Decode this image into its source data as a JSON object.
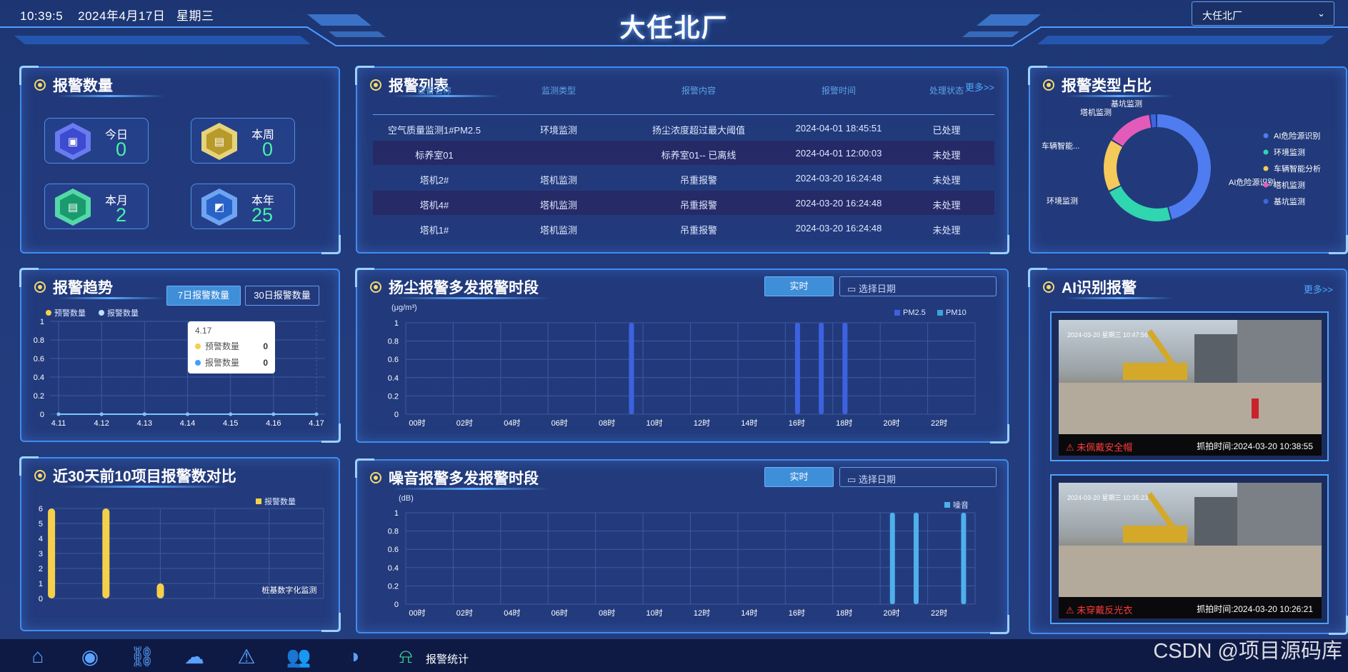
{
  "header": {
    "time": "10:39:5",
    "date": "2024年4月17日",
    "weekday": "星期三",
    "title": "大任北厂",
    "factory_select": "大任北厂"
  },
  "alarm_count": {
    "title": "报警数量",
    "cards": [
      {
        "label": "今日",
        "value": "0",
        "icon": "window-icon",
        "color": "#4d59d8"
      },
      {
        "label": "本周",
        "value": "0",
        "icon": "card-icon",
        "color": "#d4b83e"
      },
      {
        "label": "本月",
        "value": "2",
        "icon": "card-icon",
        "color": "#2bbf8a"
      },
      {
        "label": "本年",
        "value": "25",
        "icon": "chart-icon",
        "color": "#3a7ae0"
      }
    ]
  },
  "alarm_list": {
    "title": "报警列表",
    "more": "更多>>",
    "columns": [
      "设备名称",
      "监测类型",
      "报警内容",
      "报警时间",
      "处理状态"
    ],
    "rows": [
      [
        "空气质量监测1#PM2.5",
        "环境监测",
        "扬尘浓度超过最大阈值",
        "2024-04-01 18:45:51",
        "已处理"
      ],
      [
        "标养室01",
        "",
        "标养室01-- 已离线",
        "2024-04-01 12:00:03",
        "未处理"
      ],
      [
        "塔机2#",
        "塔机监测",
        "吊重报警",
        "2024-03-20 16:24:48",
        "未处理"
      ],
      [
        "塔机4#",
        "塔机监测",
        "吊重报警",
        "2024-03-20 16:24:48",
        "未处理"
      ],
      [
        "塔机1#",
        "塔机监测",
        "吊重报警",
        "2024-03-20 16:24:48",
        "未处理"
      ]
    ]
  },
  "alarm_type": {
    "title": "报警类型占比",
    "legend": [
      "AI危险源识别",
      "环境监测",
      "车辆智能分析",
      "塔机监测",
      "基坑监测"
    ],
    "callouts": [
      "基坑监测",
      "塔机监测",
      "车辆智能...",
      "环境监测",
      "AI危险源识别"
    ],
    "colors": [
      "#4f7cf0",
      "#2fd6b0",
      "#f5c95a",
      "#e35bb8",
      "#3f66e0"
    ]
  },
  "trend": {
    "title": "报警趋势",
    "tab_7": "7日报警数量",
    "tab_30": "30日报警数量",
    "legend": [
      "预警数量",
      "报警数量"
    ],
    "tooltip": {
      "date": "4.17",
      "rows": [
        {
          "label": "预警数量",
          "value": "0",
          "color": "#f5d04a"
        },
        {
          "label": "报警数量",
          "value": "0",
          "color": "#3fa0ff"
        }
      ]
    }
  },
  "dust": {
    "title": "扬尘报警多发报警时段",
    "btn_realtime": "实时",
    "date_placeholder": "选择日期",
    "unit": "(μg/m³)",
    "legend": [
      "PM2.5",
      "PM10"
    ]
  },
  "noise": {
    "title": "噪音报警多发报警时段",
    "btn_realtime": "实时",
    "date_placeholder": "选择日期",
    "unit": "(dB)",
    "legend": [
      "噪音"
    ]
  },
  "top10": {
    "title": "近30天前10项目报警数对比",
    "legend": "报警数量"
  },
  "ai": {
    "title": "AI识别报警",
    "more": "更多>>",
    "items": [
      {
        "alarm": "未佩戴安全帽",
        "capture": "抓拍时间:2024-03-20 10:38:55",
        "stamp": "2024-03-20 星期三 10:47:56"
      },
      {
        "alarm": "未穿戴反光衣",
        "capture": "抓拍时间:2024-03-20 10:26:21",
        "stamp": "2024-03-20 星期三 10:35:23"
      }
    ]
  },
  "footer": {
    "active_label": "报警统计",
    "icons": [
      "home-icon",
      "camera-icon",
      "crane-icon",
      "weather-icon",
      "warning-icon",
      "users-icon",
      "pie-icon",
      "alarm-icon"
    ]
  },
  "watermark": "CSDN @项目源码库",
  "chart_data": [
    {
      "type": "donut",
      "title": "报警类型占比",
      "categories": [
        "AI危险源识别",
        "环境监测",
        "车辆智能分析",
        "塔机监测",
        "基坑监测"
      ],
      "values": [
        46,
        22,
        16,
        14,
        2
      ]
    },
    {
      "type": "line",
      "title": "报警趋势",
      "categories": [
        "4.11",
        "4.12",
        "4.13",
        "4.14",
        "4.15",
        "4.16",
        "4.17"
      ],
      "ylim": [
        0,
        1
      ],
      "yticks": [
        "0",
        "0.2",
        "0.4",
        "0.6",
        "0.8",
        "1"
      ],
      "series": [
        {
          "name": "预警数量",
          "values": [
            0,
            0,
            0,
            0,
            0,
            0,
            0
          ]
        },
        {
          "name": "报警数量",
          "values": [
            0,
            0,
            0,
            0,
            0,
            0,
            0
          ]
        }
      ]
    },
    {
      "type": "bar",
      "title": "扬尘报警多发报警时段",
      "ylabel": "(μg/m³)",
      "x": [
        "00时",
        "02时",
        "04时",
        "06时",
        "08时",
        "10时",
        "12时",
        "14时",
        "16时",
        "18时",
        "20时",
        "22时"
      ],
      "yticks": [
        "0",
        "0.2",
        "0.4",
        "0.6",
        "0.8",
        "1"
      ],
      "ylim": [
        0,
        1
      ],
      "series": [
        {
          "name": "PM2.5",
          "hours": [
            9,
            16,
            17,
            18
          ],
          "values": [
            1,
            1,
            1,
            1
          ]
        },
        {
          "name": "PM10",
          "hours": [],
          "values": []
        }
      ]
    },
    {
      "type": "bar",
      "title": "噪音报警多发报警时段",
      "ylabel": "(dB)",
      "x": [
        "00时",
        "02时",
        "04时",
        "06时",
        "08时",
        "10时",
        "12时",
        "14时",
        "16时",
        "18时",
        "20时",
        "22时"
      ],
      "yticks": [
        "0",
        "0.2",
        "0.4",
        "0.6",
        "0.8",
        "1"
      ],
      "ylim": [
        0,
        1
      ],
      "series": [
        {
          "name": "噪音",
          "hours": [
            20,
            21,
            23
          ],
          "values": [
            1,
            1,
            1
          ]
        }
      ]
    },
    {
      "type": "bar",
      "title": "近30天前10项目报警数对比",
      "categories": [
        "",
        "",
        "",
        "",
        "桩基数字化监测"
      ],
      "values": [
        6,
        6,
        1,
        0,
        0
      ],
      "ylim": [
        0,
        6
      ],
      "yticks": [
        "0",
        "1",
        "2",
        "3",
        "4",
        "5",
        "6"
      ],
      "series": [
        {
          "name": "报警数量",
          "values": [
            6,
            6,
            1,
            0,
            0
          ]
        }
      ]
    }
  ]
}
